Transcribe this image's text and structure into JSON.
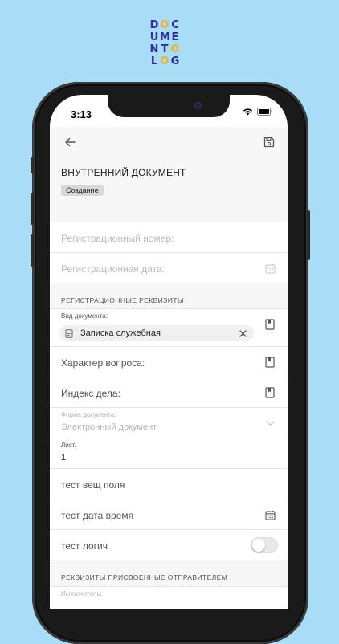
{
  "logo": {
    "letters": [
      [
        "D",
        "O",
        "C",
        ""
      ],
      [
        "U",
        "M",
        "E",
        ""
      ],
      [
        "N",
        "T",
        "O",
        ""
      ],
      [
        "L",
        "O",
        "G",
        ""
      ]
    ]
  },
  "status": {
    "time": "3:13"
  },
  "doc": {
    "title": "ВНУТРЕННИЙ ДОКУМЕНТ",
    "state_badge": "Создание"
  },
  "fields": {
    "reg_number_placeholder": "Регистрационный номер:",
    "reg_date_placeholder": "Регистрационная дата:",
    "section_reg": "РЕГИСТРАЦИОННЫЕ РЕКВИЗИТЫ",
    "doc_type_label": "Вид документа:",
    "doc_type_value": "Записка служебная",
    "question_placeholder": "Характер вопроса:",
    "case_index_placeholder": "Индекс дела:",
    "doc_form_label": "Форма документа:",
    "doc_form_value": "Электронный документ",
    "sheets_label": "Лист.",
    "sheets_value": "1",
    "test_field": "тест вещ поля",
    "test_datetime": "тест дата время",
    "test_logic": "тест логич",
    "section_sender": "РЕКВИЗИТЫ ПРИСВОЕННЫЕ ОТПРАВИТЕЛЕМ",
    "executor_label": "Исполнитель:"
  },
  "toggle": {
    "test_logic_on": false
  },
  "colors": {
    "background": "#a9dcf7",
    "logo_blue": "#2c2f9e",
    "logo_yellow": "#f0b41c"
  }
}
